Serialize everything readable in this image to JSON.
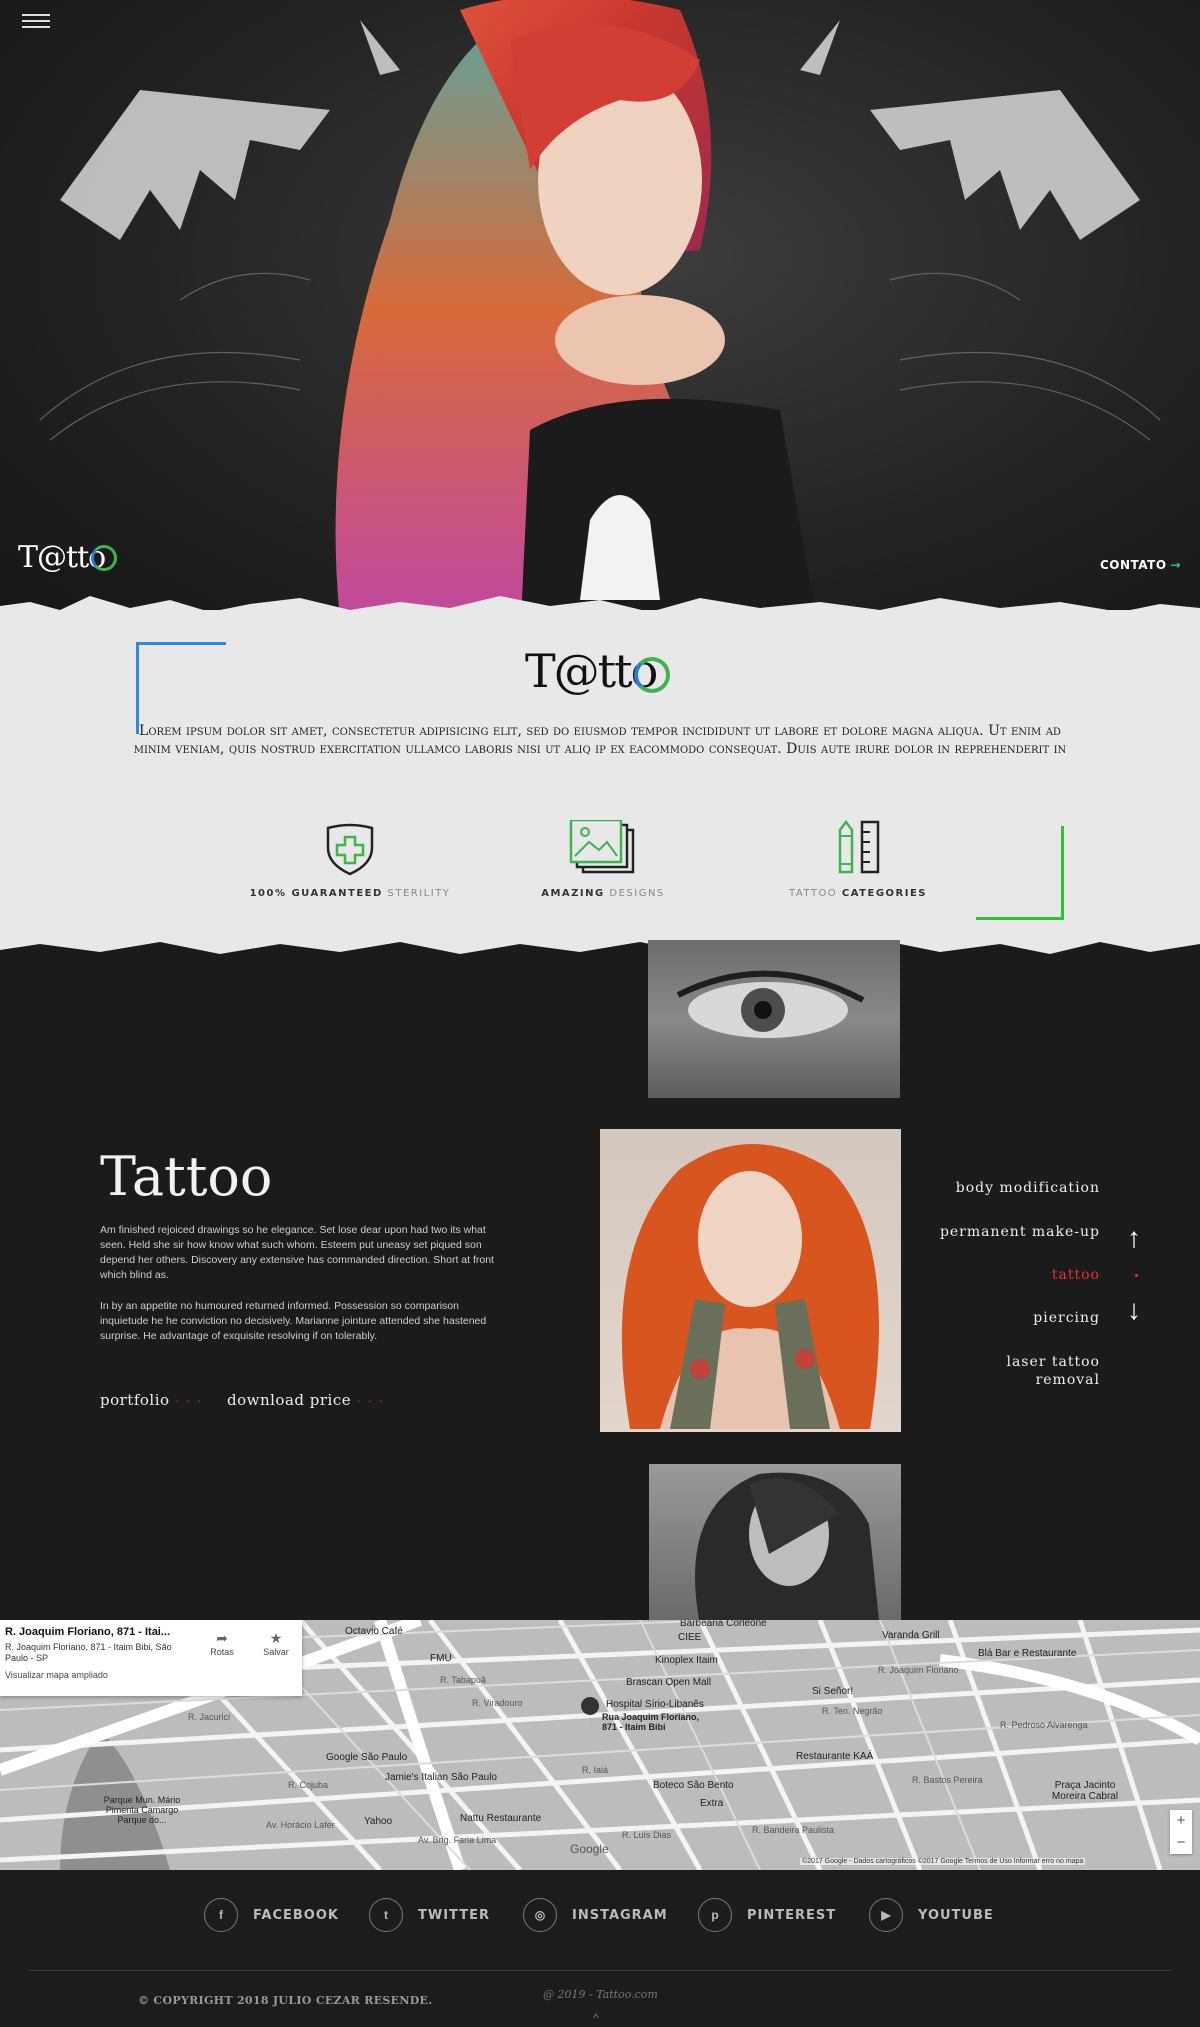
{
  "hero": {
    "logo_text": "T@tto",
    "contato_label": "CONTATO",
    "contato_arrow": "→"
  },
  "intro": {
    "logo_text": "T@tto",
    "paragraph": "Lorem ipsum dolor sit amet, consectetur adipisicing elit, sed do eiusmod tempor incididunt ut labore et dolore magna aliqua. Ut enim ad minim veniam, quis nostrud exercitation ullamco laboris nisi ut aliq ip ex eacommodo consequat. Duis aute irure dolor in reprehenderit in",
    "features": [
      {
        "strong": "100% GUARANTEED",
        "light": "STERILITY",
        "icon": "shield-cross-icon"
      },
      {
        "strong": "AMAZING",
        "light": "DESIGNS",
        "icon": "gallery-icon"
      },
      {
        "light": "TATTOO",
        "strong": "CATEGORIES",
        "icon": "pencil-ruler-icon"
      }
    ],
    "colors": {
      "blue": "#2a8be0",
      "green": "#2fbf3a"
    }
  },
  "section": {
    "title": "Tattoo",
    "paragraph1": "Am finished rejoiced drawings so he elegance. Set lose dear upon had two its what seen. Held she sir how know what such whom. Esteem put uneasy set piqued son depend her others. Discovery any extensive has commanded direction. Short at front which blind as.",
    "paragraph2": "In by an appetite no humoured returned informed. Possession so comparison inquietude he he conviction no decisively. Marianne jointure attended she hastened surprise. He advantage of exquisite resolving if on tolerably.",
    "link_portfolio": "portfolio",
    "link_download": "download price",
    "link_dots": "· · ·",
    "menu": [
      "body modification",
      "permanent make-up",
      "tattoo",
      "piercing",
      "laser tattoo removal"
    ],
    "active_index": 2,
    "accent": "#e2323b"
  },
  "map": {
    "card_title": "R. Joaquim Floriano, 871 - Itai...",
    "card_address": "R. Joaquim Floriano, 871 - Itaim Bibi, São Paulo - SP",
    "card_link": "Visualizar mapa ampliado",
    "btn_routes": "Rotas",
    "btn_save": "Salvar",
    "places": [
      "Octavio Café",
      "FMU",
      "Barbearia Corleone",
      "CIEE",
      "Kinoplex Itaim",
      "Brascan Open Mall",
      "Hospital Sírio-Libanês",
      "Si Señor!",
      "Varanda Grill",
      "Blá Bar e Restaurante",
      "Google São Paulo",
      "Jamie's Italian São Paulo",
      "Boteco São Bento",
      "Extra",
      "Restaurante KAÁ",
      "Yahoo",
      "Nattu Restaurante",
      "Praça Jacinto Moreira Cabral",
      "Parque Mun. Mário Pimenta Camargo Parque do..."
    ],
    "pin_label": "Rua Joaquim Floriano, 871 - Itaim Bibi",
    "streets": [
      "R. Tabapuã",
      "R. Viradouro",
      "R. Jacurici",
      "R. Joaquim Floriano",
      "R. Ten. Negrão",
      "R. Iaiá",
      "R. Cojuba",
      "Av. Horácio Lafer",
      "R. Bastos Pereira",
      "R. Pedroso Alvarenga",
      "Av. Brig. Faria Lima",
      "R. Luís Dias",
      "R. Bandeira Paulista"
    ],
    "credit": "©2017 Google - Dados cartográficos ©2017 Google   Termos de Uso   Informar erro no mapa",
    "google": "Google",
    "zoom_in": "+",
    "zoom_out": "−"
  },
  "footer": {
    "social": [
      {
        "label": "FACEBOOK",
        "icon": "facebook-icon",
        "glyph": "f"
      },
      {
        "label": "TWITTER",
        "icon": "twitter-icon",
        "glyph": "t"
      },
      {
        "label": "INSTAGRAM",
        "icon": "instagram-icon",
        "glyph": "◎"
      },
      {
        "label": "PINTEREST",
        "icon": "pinterest-icon",
        "glyph": "p"
      },
      {
        "label": "YOUTUBE",
        "icon": "youtube-icon",
        "glyph": "▶"
      }
    ],
    "copyright": "© COPYRIGHT 2018 JULIO CEZAR RESENDE.",
    "sub": "@ 2019 - Tattoo.com",
    "up": "^"
  }
}
